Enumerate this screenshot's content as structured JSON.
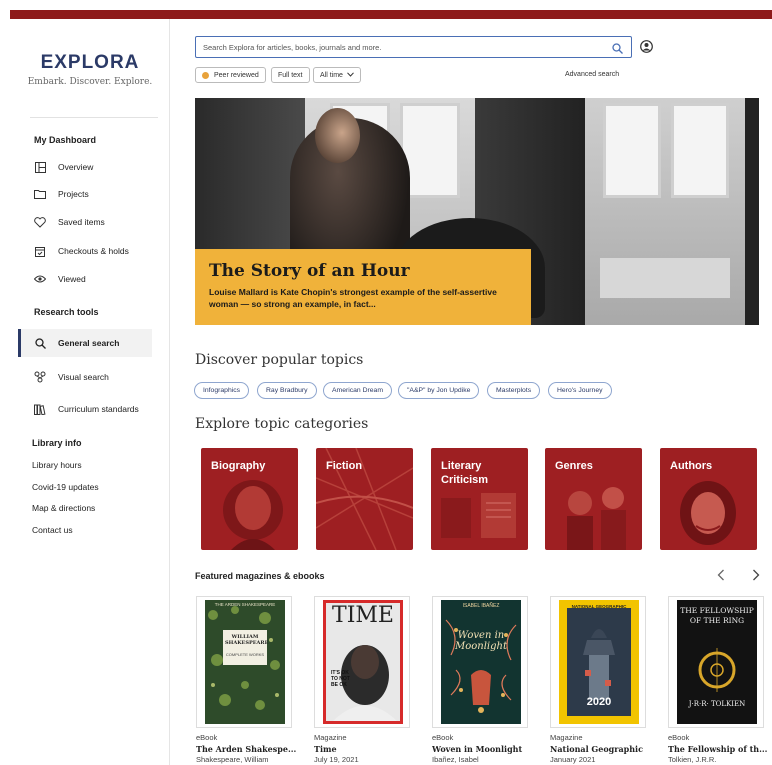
{
  "brand": {
    "title": "EXPLORA",
    "tagline": "Embark. Discover. Explore."
  },
  "sidebar": {
    "dashboard_heading": "My Dashboard",
    "dashboard_items": [
      {
        "label": "Overview",
        "icon": "overview-icon"
      },
      {
        "label": "Projects",
        "icon": "folder-icon"
      },
      {
        "label": "Saved items",
        "icon": "heart-icon"
      },
      {
        "label": "Checkouts & holds",
        "icon": "calendar-icon"
      },
      {
        "label": "Viewed",
        "icon": "eye-icon"
      }
    ],
    "research_heading": "Research tools",
    "research_items": [
      {
        "label": "General search",
        "icon": "search-icon",
        "active": true
      },
      {
        "label": "Visual search",
        "icon": "visual-search-icon"
      },
      {
        "label": "Curriculum standards",
        "icon": "books-icon"
      }
    ],
    "library_heading": "Library info",
    "library_links": [
      "Library hours",
      "Covid-19 updates",
      "Map & directions",
      "Contact us"
    ]
  },
  "search": {
    "placeholder": "Search Explora for articles, books, journals and more.",
    "filters": [
      "Peer reviewed",
      "Full text",
      "All time"
    ],
    "advanced_label": "Advanced search"
  },
  "hero": {
    "title": "The Story of an Hour",
    "description": "Louise Mallard is Kate Chopin's strongest example of the self-assertive woman — so strong an example, in fact..."
  },
  "popular": {
    "heading": "Discover popular topics",
    "topics": [
      "Infographics",
      "Ray Bradbury",
      "American Dream",
      "\"A&P\" by Jon Updike",
      "Masterplots",
      "Hero's Journey"
    ]
  },
  "categories": {
    "heading": "Explore topic categories",
    "items": [
      "Biography",
      "Fiction",
      "Literary Criticism",
      "Genres",
      "Authors"
    ]
  },
  "featured": {
    "heading": "Featured magazines & ebooks",
    "items": [
      {
        "type": "eBook",
        "title": "The Arden Shakespe...",
        "meta": "Shakespeare, William",
        "cover_title": "WILLIAM SHAKESPEARE",
        "cover_sub": "COMPLETE WORKS",
        "cover_top": "THE ARDEN SHAKESPEARE"
      },
      {
        "type": "Magazine",
        "title": "Time",
        "meta": "July 19, 2021",
        "cover_title": "TIME",
        "cover_sub": "IT'S OK TO NOT BE OK"
      },
      {
        "type": "eBook",
        "title": "Woven in Moonlight",
        "meta": "Ibañez, Isabel",
        "cover_title": "Woven in Moonlight",
        "cover_top": "ISABEL IBAÑEZ"
      },
      {
        "type": "Magazine",
        "title": "National Geographic",
        "meta": "January 2021",
        "cover_title": "2020",
        "cover_top": "NATIONAL GEOGRAPHIC"
      },
      {
        "type": "eBook",
        "title": "The Fellowship of th...",
        "meta": "Tolkien, J.R.R.",
        "cover_title": "THE FELLOWSHIP OF THE RING",
        "cover_sub": "J·R·R· TOLKIEN"
      }
    ]
  },
  "colors": {
    "brand_red": "#8e1b1b",
    "navy": "#2b3a67",
    "hero_caption": "#f0b23a",
    "category_red": "#9e1f22"
  }
}
